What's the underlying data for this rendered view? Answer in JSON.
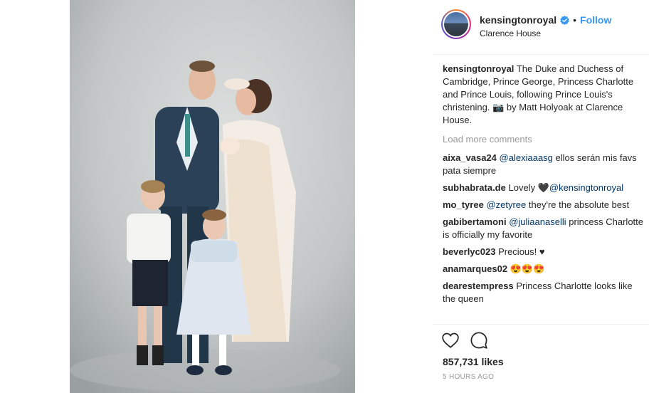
{
  "post": {
    "username": "kensingtonroyal",
    "follow_label": "Follow",
    "dot": "•",
    "location": "Clarence House"
  },
  "caption": {
    "username": "kensingtonroyal",
    "text": "The Duke and Duchess of Cambridge, Prince George, Princess Charlotte and Prince Louis, following Prince Louis's christening. 📷 by Matt Holyoak at Clarence House."
  },
  "load_more_label": "Load more comments",
  "comments": [
    {
      "username": "aixa_vasa24",
      "mention": "@alexiaaasg",
      "text": "ellos serán mis favs pata siempre"
    },
    {
      "username": "subhabrata.de",
      "text": "Lovely 🖤",
      "mention": "@kensingtonroyal"
    },
    {
      "username": "mo_tyree",
      "mention": "@zetyree",
      "text": "they're the absolute best"
    },
    {
      "username": "gabibertamoni",
      "mention": "@juliaanaselli",
      "text": "princess Charlotte is officially my favorite"
    },
    {
      "username": "beverlyc023",
      "text": "Precious! ♥"
    },
    {
      "username": "anamarques02",
      "text": "😍😍😍"
    },
    {
      "username": "dearestempress",
      "text": "Princess Charlotte looks like the queen"
    }
  ],
  "likes": "857,731 likes",
  "timestamp": "5 HOURS AGO",
  "icons": {
    "like": "heart-icon",
    "comment": "comment-icon",
    "verified": "verified-badge-icon"
  },
  "colors": {
    "link": "#3897f0",
    "mention": "#003569",
    "muted": "#999999"
  }
}
